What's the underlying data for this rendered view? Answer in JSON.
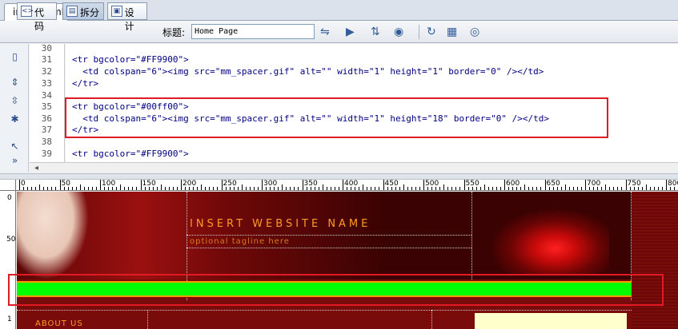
{
  "document": {
    "tab_title": "index.html*"
  },
  "toolbar": {
    "code_label": "代码",
    "split_label": "拆分",
    "design_label": "设计",
    "title_label": "标题:",
    "title_value": "Home Page"
  },
  "code_lines": [
    {
      "num": "30",
      "text": ""
    },
    {
      "num": "31",
      "text": "<tr bgcolor=\"#FF9900\">"
    },
    {
      "num": "32",
      "text": "  <td colspan=\"6\"><img src=\"mm_spacer.gif\" alt=\"\" width=\"1\" height=\"1\" border=\"0\" /></td>"
    },
    {
      "num": "33",
      "text": "</tr>"
    },
    {
      "num": "34",
      "text": ""
    },
    {
      "num": "35",
      "text": "<tr bgcolor=\"#00ff00\">"
    },
    {
      "num": "36",
      "text": "  <td colspan=\"6\"><img src=\"mm_spacer.gif\" alt=\"\" width=\"1\" height=\"18\" border=\"0\" /></td>"
    },
    {
      "num": "37",
      "text": "</tr>"
    },
    {
      "num": "38",
      "text": ""
    },
    {
      "num": "39",
      "text": "<tr bgcolor=\"#FF9900\">"
    }
  ],
  "ruler": {
    "top_labels": [
      "0",
      "50",
      "100",
      "150",
      "200",
      "250",
      "300",
      "350",
      "400",
      "450",
      "500",
      "550",
      "600",
      "650",
      "700",
      "750",
      "800"
    ],
    "left_labels": [
      "0",
      "50",
      "1"
    ]
  },
  "design": {
    "site_name": "INSERT WEBSITE NAME",
    "tagline": "optional tagline here",
    "nav_item": "ABOUT US"
  },
  "colors": {
    "highlight_box": "#e01b24",
    "spacer_row": "#00ff00",
    "accent_row": "#FF9900",
    "background": "#7a0b0b"
  }
}
